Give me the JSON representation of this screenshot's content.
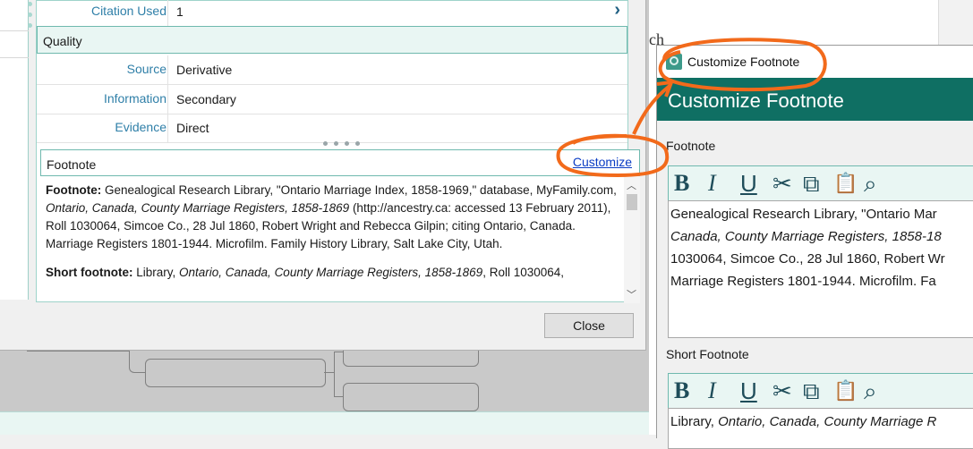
{
  "properties": {
    "citation_used_label": "Citation Used",
    "citation_used_value": "1",
    "quality_heading": "Quality",
    "source_label": "Source",
    "source_value": "Derivative",
    "information_label": "Information",
    "information_value": "Secondary",
    "evidence_label": "Evidence",
    "evidence_value": "Direct"
  },
  "footnote_panel": {
    "heading": "Footnote",
    "customize_link": "Customize",
    "footnote_label": "Footnote:",
    "footnote_text_1": " Genealogical Research Library, \"Ontario Marriage Index, 1858-1969,\" database, MyFamily.com, ",
    "footnote_italic": "Ontario, Canada, County Marriage Registers, 1858-1869",
    "footnote_text_2": " (http://ancestry.ca: accessed 13 February 2011), Roll 1030064, Simcoe Co., 28 Jul 1860, Robert Wright and Rebecca Gilpin; citing Ontario, Canada. Marriage Registers 1801-1944. Microfilm. Family History Library, Salt Lake City, Utah.",
    "short_label": "Short footnote:",
    "short_text_1": " Library, ",
    "short_italic": "Ontario, Canada, County Marriage Registers, 1858-1869",
    "short_text_2": ", Roll 1030064,"
  },
  "close_button": "Close",
  "doc_fragment": "ch",
  "customize_dialog": {
    "window_title": "Customize Footnote",
    "header": "Customize Footnote",
    "footnote_label": "Footnote",
    "short_label": "Short Footnote",
    "toolbar": {
      "bold": "B",
      "italic": "I",
      "underline": "U",
      "cut": "✂",
      "copy": "⧉",
      "paste": "📋",
      "find": "⌕"
    },
    "footnote_line1": "Genealogical Research Library, \"Ontario Mar",
    "footnote_line2_italic": "Canada, County Marriage Registers, 1858-18",
    "footnote_line3": "1030064, Simcoe Co., 28 Jul 1860, Robert Wr",
    "footnote_line4": "Marriage Registers 1801-1944. Microfilm. Fa",
    "short_line1_a": "Library, ",
    "short_line1_italic": "Ontario, Canada, County Marriage R"
  },
  "colors": {
    "accent": "#0f6f63",
    "panel_border": "#6fb9ae",
    "annotation": "#f26a1b",
    "link": "#0a3cc4"
  }
}
